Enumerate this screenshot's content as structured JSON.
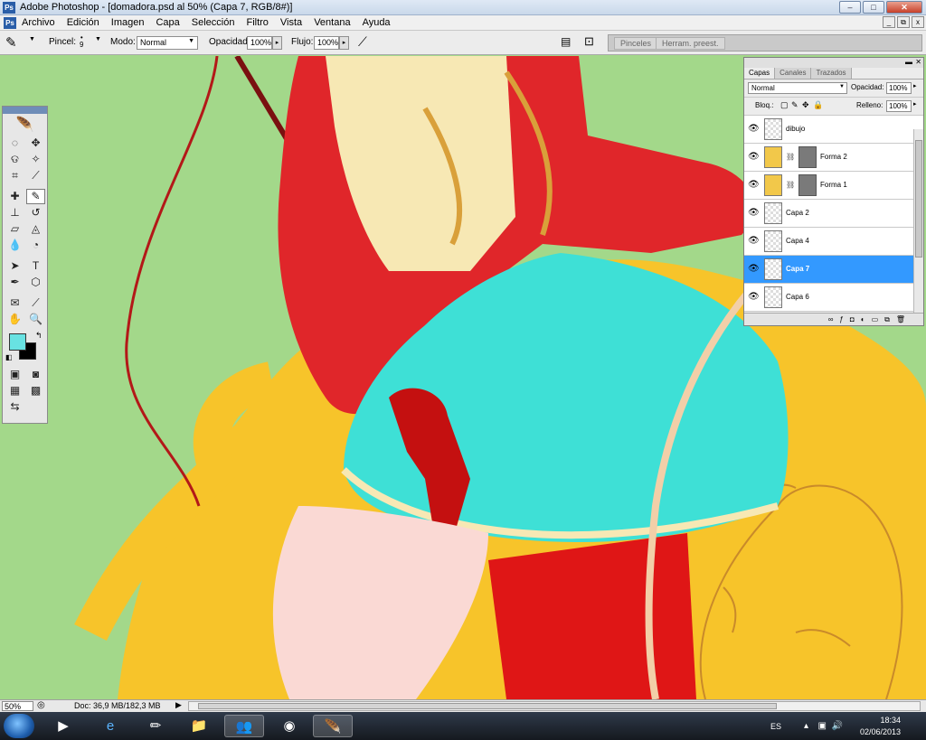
{
  "window": {
    "title": "Adobe Photoshop - [domadora.psd al 50% (Capa 7, RGB/8#)]",
    "app_icon": "Ps",
    "minimize": "–",
    "maximize": "□",
    "close": "✕"
  },
  "menu": {
    "items": [
      "Archivo",
      "Edición",
      "Imagen",
      "Capa",
      "Selección",
      "Filtro",
      "Vista",
      "Ventana",
      "Ayuda"
    ],
    "doc_min": "_",
    "doc_restore": "⧉",
    "doc_close": "x"
  },
  "options_bar": {
    "brush_label": "Pincel:",
    "brush_size": "9",
    "mode_label": "Modo:",
    "mode_value": "Normal",
    "opacity_label": "Opacidad:",
    "opacity_value": "100%",
    "flow_label": "Flujo:",
    "flow_value": "100%",
    "palette_tabs": [
      "Pinceles",
      "Herram. preest."
    ]
  },
  "tools": {
    "active_tool": "brush-tool",
    "foreground_color": "#68e2e2",
    "background_color": "#000000"
  },
  "layers_panel": {
    "tabs": [
      "Capas",
      "Canales",
      "Trazados"
    ],
    "blend_mode": "Normal",
    "opacity_label": "Opacidad:",
    "opacity_value": "100%",
    "lock_label": "Bloq.:",
    "fill_label": "Relleno:",
    "fill_value": "100%",
    "layers": [
      {
        "name": "dibujo",
        "type": "pixel",
        "selected": false
      },
      {
        "name": "Forma 2",
        "type": "shape",
        "selected": false
      },
      {
        "name": "Forma 1",
        "type": "shape",
        "selected": false
      },
      {
        "name": "Capa 2",
        "type": "pixel",
        "selected": false
      },
      {
        "name": "Capa 4",
        "type": "pixel",
        "selected": false
      },
      {
        "name": "Capa 7",
        "type": "pixel",
        "selected": true
      },
      {
        "name": "Capa 6",
        "type": "pixel",
        "selected": false
      }
    ]
  },
  "status_bar": {
    "zoom": "50%",
    "doc_info": "Doc: 36,9 MB/182,3 MB"
  },
  "taskbar": {
    "language": "ES",
    "time": "18:34",
    "date": "02/06/2013"
  }
}
